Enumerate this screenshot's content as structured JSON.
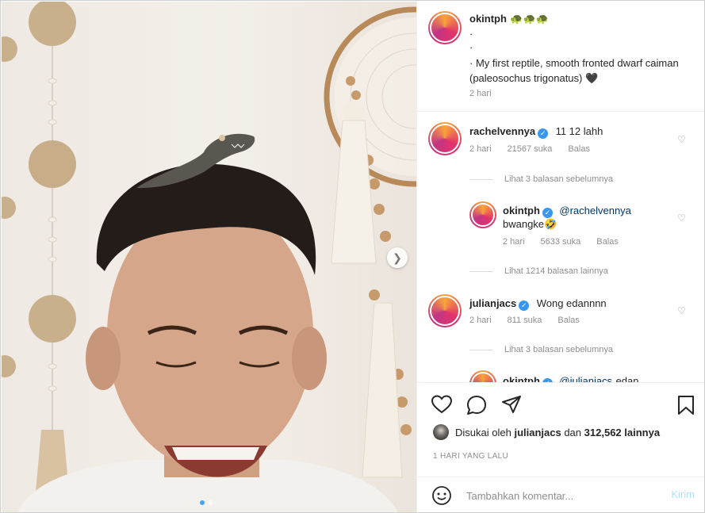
{
  "post": {
    "author": "okintph",
    "author_emoji": "🐢🐢🐢",
    "caption_lines": [
      "·",
      "·",
      "· My first reptile, smooth fronted dwarf caiman (paleosochus trigonatus) 🖤"
    ],
    "time": "2 hari"
  },
  "comments": [
    {
      "user": "rachelvennya",
      "verified": true,
      "text": "11 12 lahh",
      "time": "2 hari",
      "likes": "21567 suka",
      "reply": "Balas",
      "thread_label": "Lihat 3 balasan sebelumnya",
      "replies": [
        {
          "user": "okintph",
          "verified": true,
          "mention": "@rachelvennya",
          "text": "bwangke🤣",
          "time": "2 hari",
          "likes": "5633 suka",
          "reply": "Balas"
        }
      ],
      "more_label": "Lihat 1214 balasan lainnya"
    },
    {
      "user": "julianjacs",
      "verified": true,
      "text": "Wong edannnn",
      "time": "2 hari",
      "likes": "811 suka",
      "reply": "Balas",
      "thread_label": "Lihat 3 balasan sebelumnya",
      "replies": [
        {
          "user": "okintph",
          "verified": true,
          "mention": "@julianjacs",
          "text": "edan..."
        }
      ]
    }
  ],
  "likes": {
    "prefix": "Disukai oleh",
    "user": "julianjacs",
    "joiner": "dan",
    "count": "312,562 lainnya"
  },
  "date_label": "1 HARI YANG LALU",
  "add_comment": {
    "placeholder": "Tambahkan komentar...",
    "post": "Kirim"
  },
  "icons": {
    "heart": "heart-icon",
    "comment": "comment-icon",
    "share": "share-icon",
    "bookmark": "bookmark-icon",
    "emoji": "emoji-icon",
    "next": "chevron-right-icon"
  },
  "colors": {
    "verified": "#3897f0",
    "link": "#003569",
    "post_disabled": "#b2dffc"
  }
}
